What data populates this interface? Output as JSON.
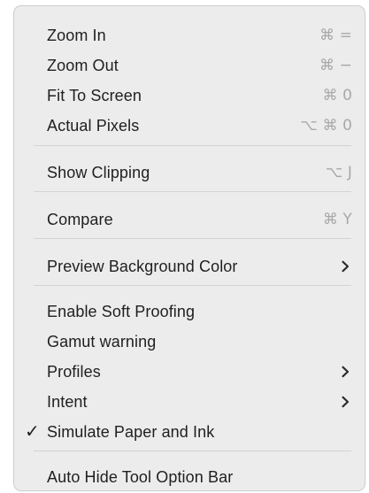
{
  "menu": {
    "items": [
      {
        "label": "Zoom In",
        "shortcut": "⌘ ="
      },
      {
        "label": "Zoom Out",
        "shortcut": "⌘ −"
      },
      {
        "label": "Fit To Screen",
        "shortcut": "⌘ 0"
      },
      {
        "label": "Actual Pixels",
        "shortcut": "⌥ ⌘ 0"
      },
      {
        "label": "Show Clipping",
        "shortcut": "⌥ J"
      },
      {
        "label": "Compare",
        "shortcut": "⌘ Y"
      },
      {
        "label": "Preview Background Color",
        "submenu_icon": "chevron-right-icon"
      },
      {
        "label": "Enable Soft Proofing"
      },
      {
        "label": "Gamut warning"
      },
      {
        "label": "Profiles",
        "submenu_icon": "chevron-right-icon"
      },
      {
        "label": "Intent",
        "submenu_icon": "chevron-right-icon"
      },
      {
        "label": "Simulate Paper and Ink",
        "checked": true,
        "check_mark": "✓"
      },
      {
        "label": "Auto Hide Tool Option Bar"
      }
    ]
  },
  "colors": {
    "menu_background": "#ececec",
    "text": "#1f1f1f",
    "shortcut_text": "#a8a8a8",
    "separator": "#d3d3d3"
  }
}
